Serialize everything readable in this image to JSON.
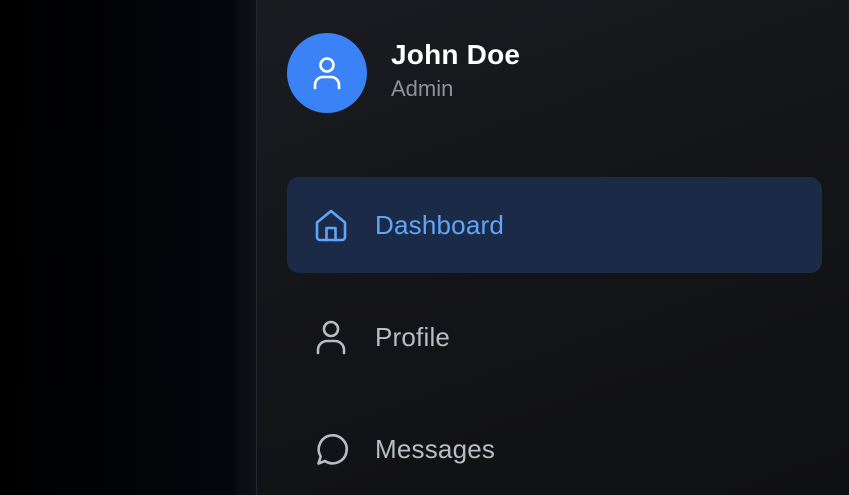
{
  "user": {
    "name": "John Doe",
    "role": "Admin"
  },
  "nav": {
    "items": [
      {
        "label": "Dashboard",
        "icon": "home-icon",
        "active": true
      },
      {
        "label": "Profile",
        "icon": "user-icon",
        "active": false
      },
      {
        "label": "Messages",
        "icon": "message-icon",
        "active": false
      }
    ]
  },
  "colors": {
    "accent": "#3b82f6",
    "active_text": "#60a5fa",
    "active_bg": "#1b2a47",
    "inactive_text": "#b9bcc2"
  }
}
